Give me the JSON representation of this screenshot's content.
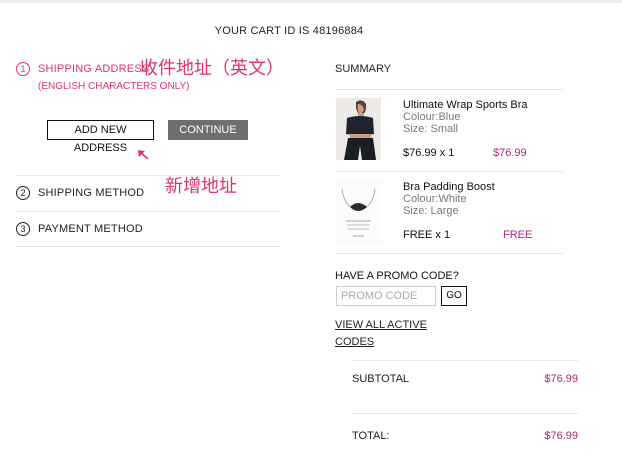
{
  "header": {
    "cart_id_text": "YOUR CART ID IS 48196884"
  },
  "steps": [
    {
      "number": "1",
      "label": "SHIPPING ADDRESS",
      "note": "(ENGLISH CHARACTERS ONLY)"
    },
    {
      "number": "2",
      "label": "SHIPPING METHOD"
    },
    {
      "number": "3",
      "label": "PAYMENT METHOD"
    }
  ],
  "shipping": {
    "add_new_address_label": "ADD NEW ADDRESS",
    "continue_label": "CONTINUE"
  },
  "annotations": {
    "address_hint": "收件地址（英文）",
    "add_address_hint": "新增地址"
  },
  "summary": {
    "title": "SUMMARY",
    "items": [
      {
        "name": "Ultimate Wrap Sports Bra",
        "colour": "Colour:Blue",
        "size": "Size: Small",
        "qty": "$76.99 x 1",
        "price": "$76.99"
      },
      {
        "name": "Bra Padding Boost",
        "colour": "Colour:White",
        "size": "Size: Large",
        "qty": "FREE x 1",
        "price": "FREE"
      }
    ]
  },
  "promo": {
    "title": "HAVE A PROMO CODE?",
    "placeholder": "PROMO CODE",
    "go_label": "GO",
    "link_line1": "VIEW ALL ACTIVE",
    "link_line2": "CODES"
  },
  "totals": {
    "subtotal_label": "SUBTOTAL",
    "subtotal_value": "$76.99",
    "total_label": "TOTAL:",
    "total_value": "$76.99"
  },
  "colors": {
    "accent": "#e0336e",
    "price": "#a8287d",
    "button_gray": "#6f6f6f"
  }
}
